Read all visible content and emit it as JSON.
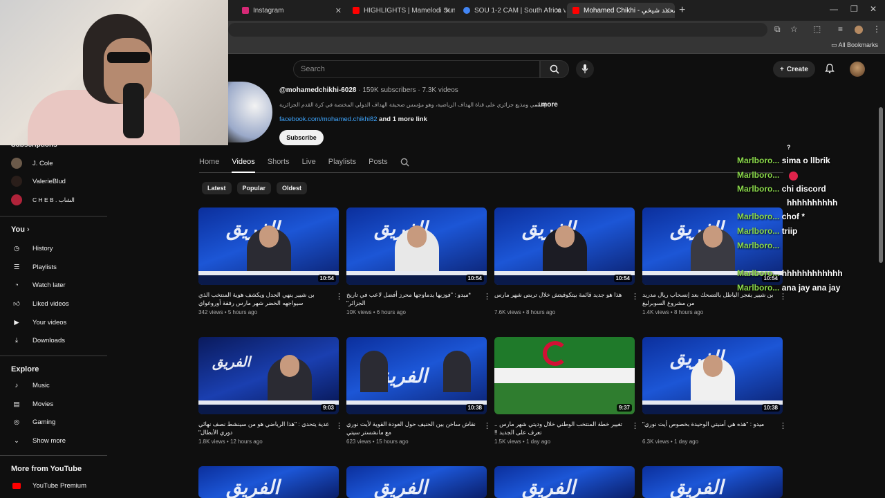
{
  "browser": {
    "tabs": [
      {
        "label": "Instagram",
        "color": "#d62976"
      },
      {
        "label": "HIGHLIGHTS | Mamelodi Sundo",
        "color": "#ff0000"
      },
      {
        "label": "SOU 1-2 CAM | South Africa v C",
        "color": "#4285f4"
      },
      {
        "label": "Mohamed Chikhi - محمد شيخي",
        "color": "#ff0000"
      }
    ],
    "all_bookmarks": "All Bookmarks"
  },
  "header": {
    "search_placeholder": "Search",
    "create_label": "Create"
  },
  "channel": {
    "handle": "@mohamedchikhi-6028",
    "stats": " · 159K subscribers · 7.3K videos",
    "description": "إعلامي ومذيع جزائري على قناة الهداف الرياضية، وهو مؤسس صحيفة الهداف الدولي المختصة في كرة القدم الجزائرية",
    "more": "...more",
    "link": "facebook.com/mohamed.chikhi82",
    "link_more": "and 1 more link",
    "subscribe": "Subscribe"
  },
  "tabs": [
    "Home",
    "Videos",
    "Shorts",
    "Live",
    "Playlists",
    "Posts"
  ],
  "chips": [
    "Latest",
    "Popular",
    "Oldest"
  ],
  "sidebar": {
    "subscriptions_heading": "Subscriptions",
    "subscriptions": [
      {
        "label": "J. Cole",
        "color": "#6b5a4a"
      },
      {
        "label": "ValerieBlud",
        "color": "#2a1e1a"
      },
      {
        "label": "C H E B . الشاب",
        "color": "#b0233a"
      }
    ],
    "you_heading": "You",
    "you_items": [
      "History",
      "Playlists",
      "Watch later",
      "Liked videos",
      "Your videos",
      "Downloads"
    ],
    "explore_heading": "Explore",
    "explore_items": [
      "Music",
      "Movies",
      "Gaming",
      "Show more"
    ],
    "more_heading": "More from YouTube",
    "more_items": [
      "YouTube Premium"
    ]
  },
  "videos": [
    {
      "title": "بن شيير ينهي الجدل ويكشف هوية المنتخب الذي سيواجهه الخضر شهر مارس رفقة أوروغواي",
      "views": "342 views",
      "age": "5 hours ago",
      "duration": "10:54"
    },
    {
      "title": "*ميدو : \"فوزيها يدماوجها محرز أفضل لاعب في تاريخ الجزائر\"",
      "views": "10K views",
      "age": "6 hours ago",
      "duration": "10:54"
    },
    {
      "title": "هذا هو جديد قائمة بيتكوفيتش خلال تربص شهر مارس",
      "views": "7.6K views",
      "age": "8 hours ago",
      "duration": "10:54"
    },
    {
      "title": "بن شيير يفجر الباطل بالتصحك بعد إنسحاب ريال مدريد من مشروع السوبرليغ",
      "views": "1.4K views",
      "age": "8 hours ago",
      "duration": "10:54"
    },
    {
      "title": "عدية يتحدى : \"هذا الرياضي هو من سينشط نصف نهائي دوري الأبطال\"",
      "views": "1.8K views",
      "age": "12 hours ago",
      "duration": "9:03"
    },
    {
      "title": "نقاش ساخن بين الحنيف حول العودة القوية لأيت نوري مع مانشستر سيتي",
      "views": "623 views",
      "age": "15 hours ago",
      "duration": "10:38"
    },
    {
      "title": "تغيير خطة المنتخب الوطني خلال وديتي شهر مارس .. تعرف على الجديد !!",
      "views": "1.5K views",
      "age": "1 day ago",
      "duration": "9:37"
    },
    {
      "title": "ميدو : \"هذه هي أمنيتي الوحيدة بخصوص أيت نوري\"",
      "views": "6.3K views",
      "age": "1 day ago",
      "duration": "10:38"
    }
  ],
  "thumb_brand": "الفريق",
  "chat": [
    {
      "user": "",
      "msg": "?"
    },
    {
      "user": "Marlboro...",
      "msg": "sima o llbrik"
    },
    {
      "user": "Marlboro...",
      "msg": ""
    },
    {
      "user": "Marlboro...",
      "msg": "chi discord"
    },
    {
      "user": "",
      "msg": "hhhhhhhhhh"
    },
    {
      "user": "Marlboro...",
      "msg": "chof *"
    },
    {
      "user": "Marlboro...",
      "msg": "triip"
    },
    {
      "user": "Marlboro...",
      "msg": ""
    },
    {
      "user": "Marlboro...",
      "msg": "hhhhhhhhhhhh"
    },
    {
      "user": "Marlboro...",
      "msg": "ana jay ana jay"
    }
  ]
}
